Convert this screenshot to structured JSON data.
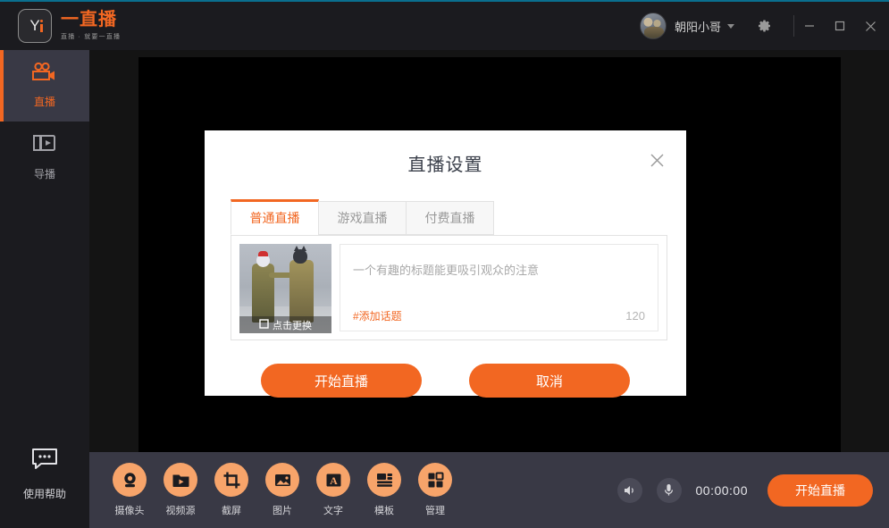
{
  "app": {
    "logo_title": "一直播",
    "logo_subtitle": "直播 · 就要一直播",
    "logo_mark_icon": "y-logo-icon"
  },
  "titlebar": {
    "username": "朝阳小哥",
    "caret_icon": "chevron-down-icon",
    "settings_icon": "gear-icon",
    "minimize_icon": "minimize-icon",
    "maximize_icon": "maximize-icon",
    "close_icon": "close-icon",
    "avatar_icon": "user-avatar"
  },
  "sidebar": {
    "items": [
      {
        "label": "直播",
        "icon": "video-camera-icon",
        "active": true
      },
      {
        "label": "导播",
        "icon": "switcher-icon",
        "active": false
      }
    ],
    "help": {
      "label": "使用帮助",
      "icon": "chat-bubble-icon"
    }
  },
  "toolbar": {
    "tools": [
      {
        "label": "摄像头",
        "icon": "webcam-icon"
      },
      {
        "label": "视频源",
        "icon": "video-folder-icon"
      },
      {
        "label": "截屏",
        "icon": "crop-screen-icon"
      },
      {
        "label": "图片",
        "icon": "image-icon"
      },
      {
        "label": "文字",
        "icon": "text-icon"
      },
      {
        "label": "模板",
        "icon": "layout-template-icon"
      },
      {
        "label": "管理",
        "icon": "manage-grid-icon"
      }
    ],
    "volume_icon": "speaker-icon",
    "mic_icon": "microphone-icon",
    "timer": "00:00:00",
    "go_live_label": "开始直播"
  },
  "modal": {
    "title": "直播设置",
    "close_icon": "close-icon",
    "tabs": [
      {
        "label": "普通直播",
        "active": true
      },
      {
        "label": "游戏直播",
        "active": false
      },
      {
        "label": "付费直播",
        "active": false
      }
    ],
    "thumbnail": {
      "change_label": "点击更换",
      "change_icon": "swap-image-icon"
    },
    "title_input": {
      "placeholder": "一个有趣的标题能更吸引观众的注意",
      "value": ""
    },
    "topic_label": "#添加话题",
    "char_counter": "120",
    "primary_button": "开始直播",
    "secondary_button": "取消"
  },
  "colors": {
    "accent": "#f26722",
    "titlebar_bg": "#1b1b1f",
    "toolbar_bg": "#393945",
    "stage_bg": "#141414",
    "tool_icon_bg": "#f7a46a"
  }
}
